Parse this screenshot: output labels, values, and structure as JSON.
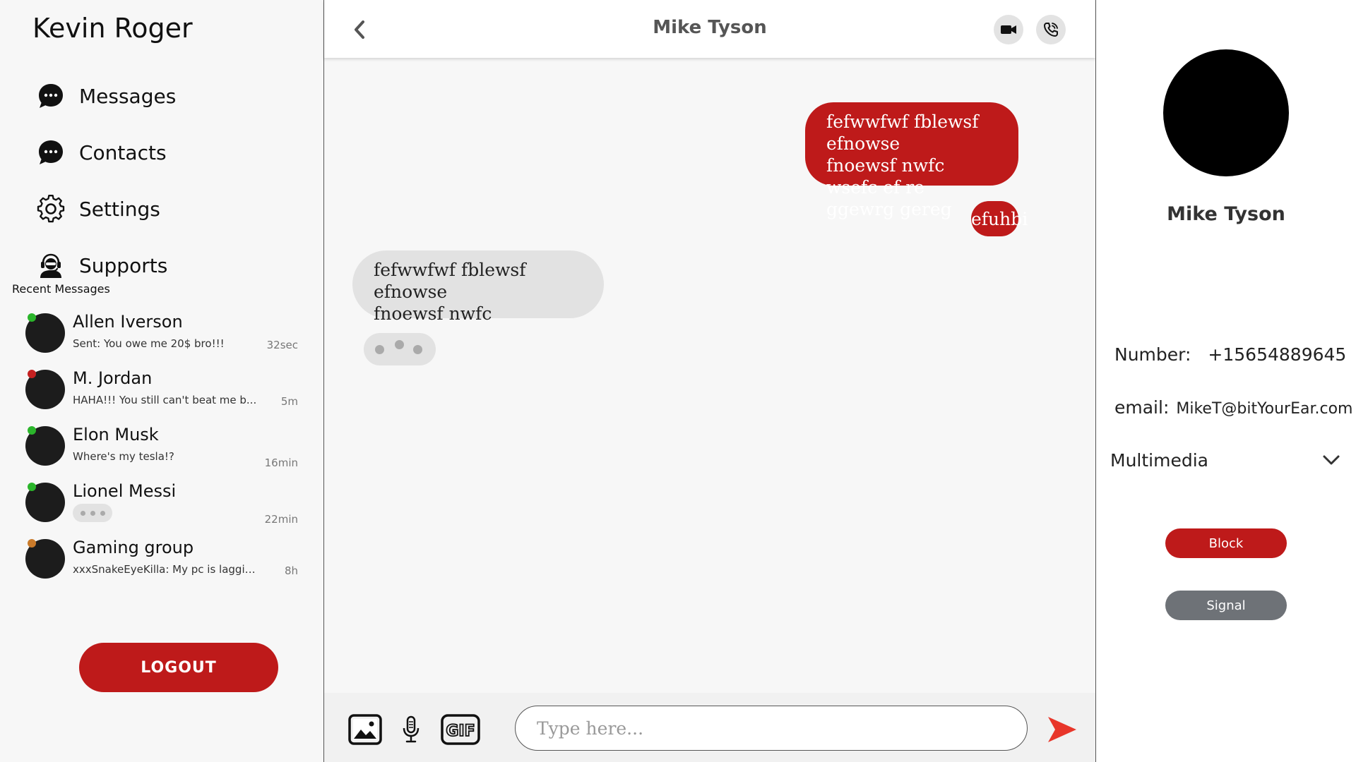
{
  "sidebar": {
    "user_name": "Kevin Roger",
    "nav": [
      {
        "label": "Messages",
        "icon": "chat-bubble-icon"
      },
      {
        "label": "Contacts",
        "icon": "chat-bubble-icon"
      },
      {
        "label": "Settings",
        "icon": "gear-icon"
      },
      {
        "label": "Supports",
        "icon": "support-agent-icon"
      }
    ],
    "recent_title": "Recent Messages",
    "recent": [
      {
        "name": "Allen Iverson",
        "preview": "Sent: You owe me 20$ bro!!!",
        "time": "32sec",
        "status_color": "#2bb52b"
      },
      {
        "name": "M. Jordan",
        "preview": "HAHA!!! You still can't beat me b...",
        "time": "5m",
        "status_color": "#c42020"
      },
      {
        "name": "Elon Musk",
        "preview": "Where's my tesla!?",
        "time": "16min",
        "status_color": "#2bb52b"
      },
      {
        "name": "Lionel Messi",
        "preview": "",
        "typing": true,
        "time": "22min",
        "status_color": "#2bb52b"
      },
      {
        "name": "Gaming group",
        "preview": "xxxSnakeEyeKilla: My pc is laggin...",
        "time": "8h",
        "status_color": "#c97a2a"
      }
    ],
    "logout_label": "LOGOUT"
  },
  "chat": {
    "contact_name": "Mike Tyson",
    "messages": [
      {
        "direction": "out",
        "text": "fefwwfwf fblewsf efnowse\nfnoewsf nwfc\nwsefc ef re ggewrg gereg"
      },
      {
        "direction": "out",
        "text": "efuhbi"
      },
      {
        "direction": "in",
        "text": "fefwwfwf fblewsf efnowse\nfnoewsf nwfc"
      }
    ],
    "typing_indicator": true,
    "input_placeholder": "Type here...",
    "gif_label": "GIF"
  },
  "profile": {
    "name": "Mike Tyson",
    "number_label": "Number:",
    "number_value": "+15654889645",
    "email_label": "email:",
    "email_value": "MikeT@bitYourEar.com",
    "multimedia_label": "Multimedia",
    "block_label": "Block",
    "signal_label": "Signal"
  },
  "colors": {
    "accent": "#be1a1a",
    "send_arrow": "#e8362a",
    "signal_button": "#6e7277",
    "bubble_incoming": "#e2e2e2"
  }
}
